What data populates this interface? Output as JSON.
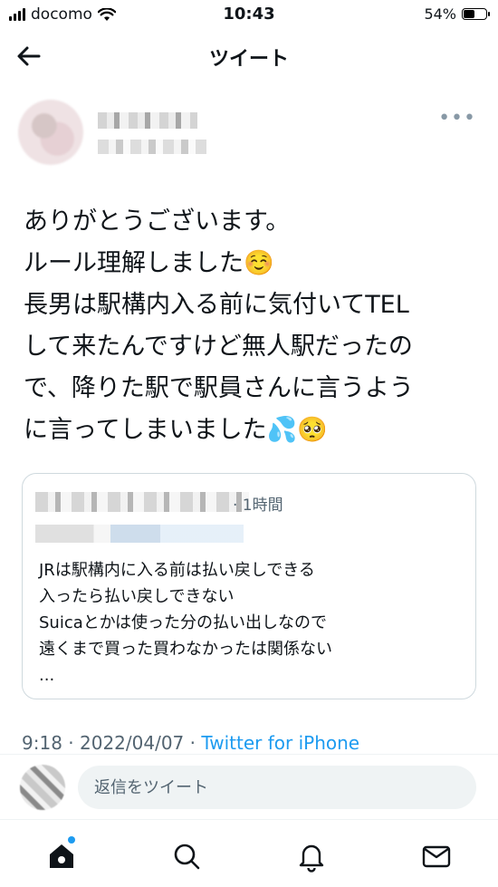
{
  "status_bar": {
    "carrier": "docomo",
    "time": "10:43",
    "battery_text": "54%",
    "battery_level": 0.54,
    "signal_icon": "signal-bars-icon",
    "wifi_icon": "wifi-icon",
    "battery_icon": "battery-icon"
  },
  "nav": {
    "title": "ツイート",
    "back_icon": "arrow-left-icon"
  },
  "tweet": {
    "text": "ありがとうございます。\nルール理解しました☺️\n長男は駅構内入る前に気付いてTEL\nして来たんですけど無人駅だったの\nで、降りた駅で駅員さんに言うよう\nに言ってしまいました💦🥺",
    "more_icon": "more-horizontal-icon"
  },
  "quote": {
    "time": "· 1時間",
    "text": "JRは駅構内に入る前は払い戻しできる\n入ったら払い戻しできない\nSuicaとかは使った分の払い出しなので\n遠くまで買った買わなかったは関係ない\n..."
  },
  "meta": {
    "time": "9:18",
    "date": "2022/04/07",
    "source": "Twitter for iPhone"
  },
  "reply": {
    "placeholder": "返信をツイート"
  },
  "tab_bar": {
    "icons": [
      "home-icon",
      "search-icon",
      "notifications-icon",
      "messages-icon"
    ]
  },
  "colors": {
    "accent": "#1d9bf0",
    "text": "#0f1419",
    "secondary": "#536471",
    "border": "#cfd9de"
  }
}
